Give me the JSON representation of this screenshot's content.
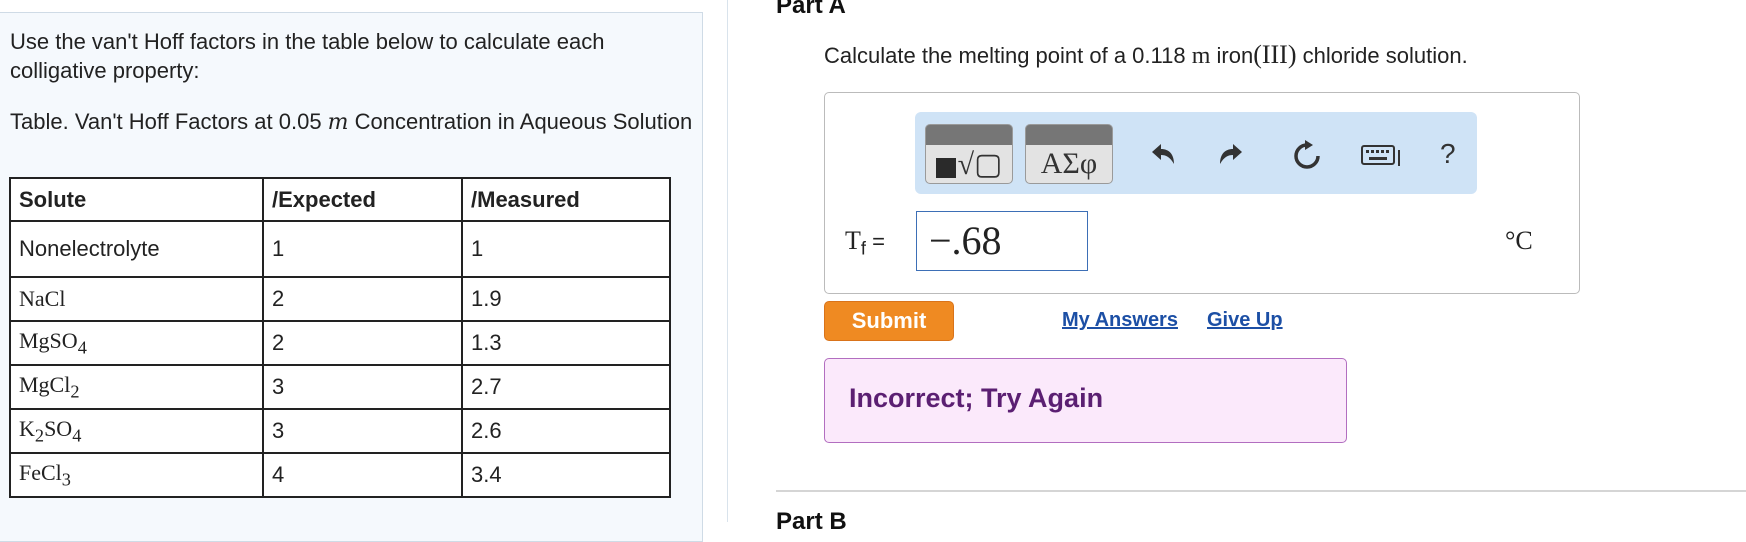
{
  "intro": "Use the van't Hoff factors in the table below to calculate each colligative property:",
  "table": {
    "title_prefix": "Table. Van't Hoff Factors at 0.05 ",
    "title_m": "m",
    "title_suffix": " Concentration in Aqueous Solution",
    "headers": [
      "Solute",
      "/Expected",
      "/Measured"
    ],
    "rows": [
      {
        "solute": "Nonelectrolyte",
        "expected": "1",
        "measured": "1"
      },
      {
        "solute": "NaCl",
        "expected": "2",
        "measured": "1.9"
      },
      {
        "solute_main": "MgSO",
        "solute_sub": "4",
        "expected": "2",
        "measured": "1.3"
      },
      {
        "solute_main": "MgCl",
        "solute_sub": "2",
        "expected": "3",
        "measured": "2.7"
      },
      {
        "solute_a": "K",
        "solute_sub1": "2",
        "solute_b": "SO",
        "solute_sub2": "4",
        "expected": "3",
        "measured": "2.6"
      },
      {
        "solute_main": "FeCl",
        "solute_sub": "3",
        "expected": "4",
        "measured": "3.4"
      }
    ]
  },
  "part_a": {
    "title": "Part A",
    "question_prefix": "Calculate the melting point of a 0.118 ",
    "question_unit": "m",
    "question_mid": " iron",
    "question_roman": "(III)",
    "question_suffix": " chloride solution."
  },
  "toolbar": {
    "templates_glyph": "√▢",
    "symbols_glyph": "ΑΣφ",
    "help_label": "?"
  },
  "answer": {
    "label_var": "T",
    "label_sub": "f",
    "label_eq": " =",
    "value": "−.68",
    "unit": "°C"
  },
  "actions": {
    "submit": "Submit",
    "my_answers": "My Answers",
    "give_up": "Give Up"
  },
  "feedback": "Incorrect; Try Again",
  "part_b": {
    "title": "Part B"
  },
  "colors": {
    "submit": "#ef8a22",
    "feedback_bg": "#fbe9fb",
    "feedback_text": "#5b1f72",
    "link": "#1c4fa5",
    "toolbar_bg": "#cfe3f6"
  }
}
